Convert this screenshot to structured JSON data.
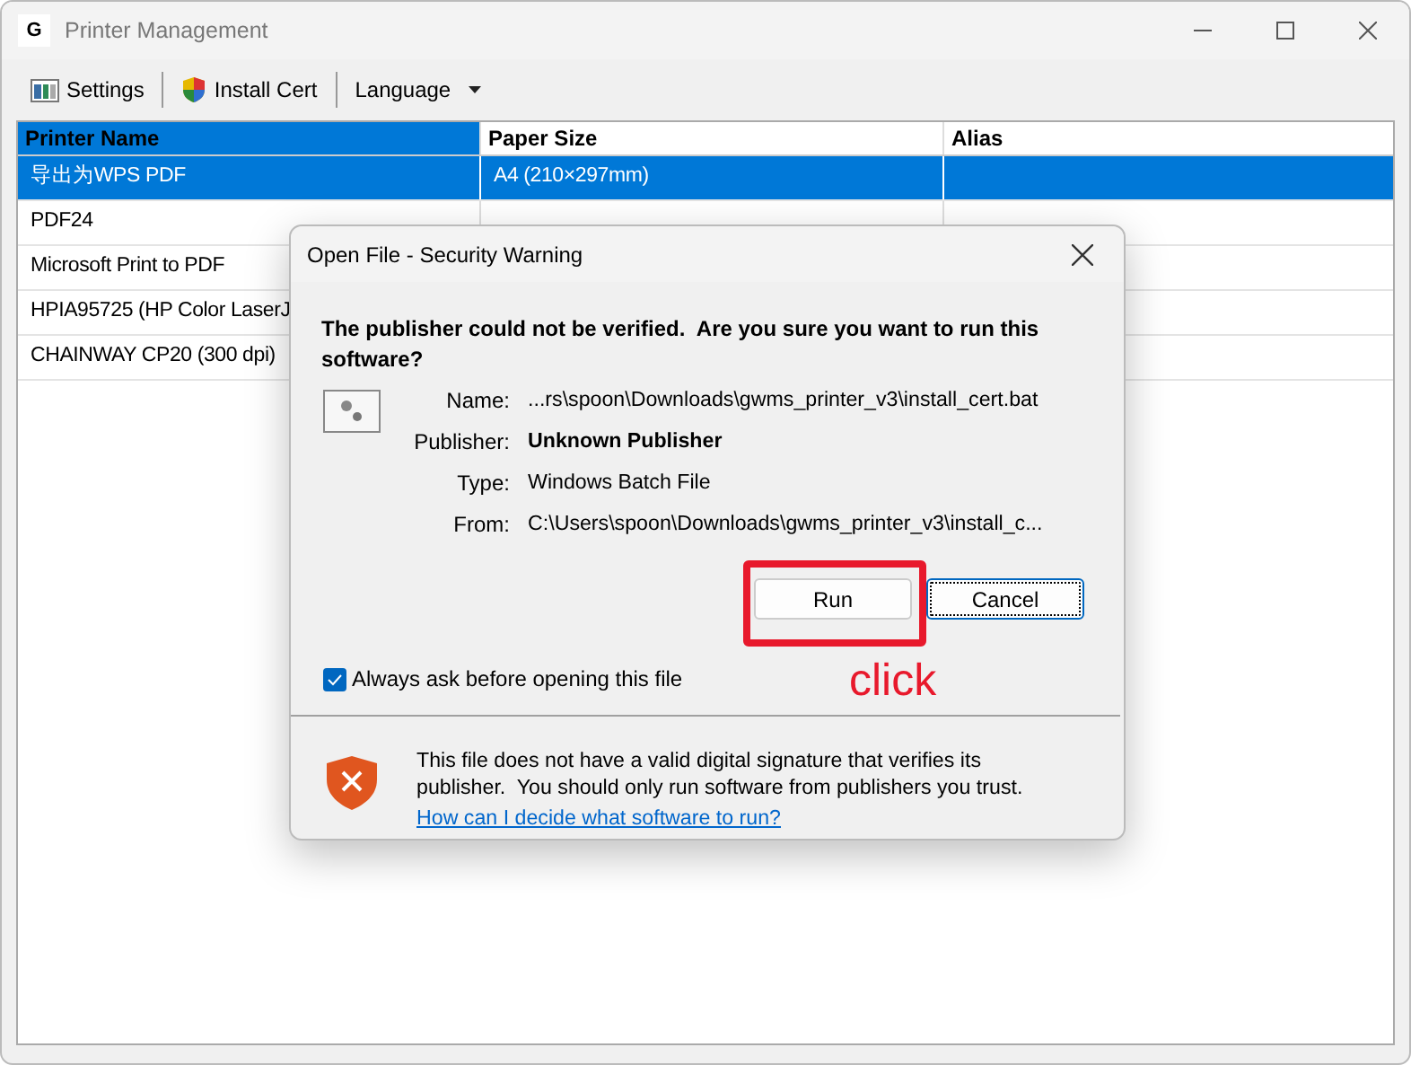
{
  "window": {
    "title": "Printer Management",
    "app_icon": "G"
  },
  "toolbar": [
    {
      "kind": "button",
      "label": "Settings"
    },
    {
      "kind": "button",
      "label": "Install Cert"
    },
    {
      "kind": "dropdown",
      "label": "Language"
    }
  ],
  "table": {
    "columns": [
      {
        "label": "Printer Name",
        "highlighted": true
      },
      {
        "label": "Paper Size",
        "highlighted": false
      },
      {
        "label": "Alias",
        "highlighted": false
      }
    ],
    "rows": [
      {
        "cells": [
          "导出为WPS PDF",
          "A4 (210×297mm)",
          ""
        ],
        "selected": true
      },
      {
        "cells": [
          "PDF24",
          "",
          ""
        ],
        "selected": false
      },
      {
        "cells": [
          "Microsoft Print to PDF",
          "",
          ""
        ],
        "selected": false
      },
      {
        "cells": [
          "HPIA95725 (HP Color LaserJ",
          "",
          ""
        ],
        "selected": false
      },
      {
        "cells": [
          "CHAINWAY CP20 (300 dpi)",
          "",
          ""
        ],
        "selected": false
      }
    ]
  },
  "dialog": {
    "title": "Open File - Security Warning",
    "heading": "The publisher could not be verified.  Are you sure you want to run this software?",
    "fields": [
      {
        "label": "Name:",
        "value": "...rs\\spoon\\Downloads\\gwms_printer_v3\\install_cert.bat",
        "bold": false
      },
      {
        "label": "Publisher:",
        "value": "Unknown Publisher",
        "bold": true
      },
      {
        "label": "Type:",
        "value": "Windows Batch File",
        "bold": false
      },
      {
        "label": "From:",
        "value": "C:\\Users\\spoon\\Downloads\\gwms_printer_v3\\install_c...",
        "bold": false
      }
    ],
    "buttons": [
      {
        "label": "Run",
        "focused": false,
        "annotated": true
      },
      {
        "label": "Cancel",
        "focused": true,
        "annotated": false
      }
    ],
    "checkbox": {
      "label": "Always ask before opening this file",
      "checked": true
    },
    "warning": "This file does not have a valid digital signature that verifies its publisher.  You should only run software from publishers you trust.",
    "link": "How can I decide what software to run?"
  },
  "annotation": {
    "text": "click"
  }
}
